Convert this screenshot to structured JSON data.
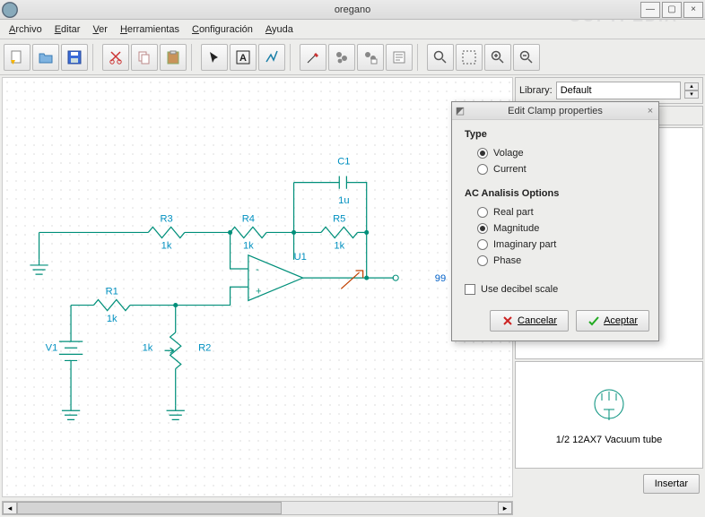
{
  "window": {
    "title": "oregano"
  },
  "menu": {
    "file": "Archivo",
    "edit": "Editar",
    "view": "Ver",
    "tools": "Herramientas",
    "config": "Configuración",
    "help": "Ayuda"
  },
  "toolbar": {
    "new": "new",
    "open": "open",
    "save": "save",
    "cut": "cut",
    "copy": "copy",
    "paste": "paste",
    "arrow": "arrow",
    "text": "text",
    "wire": "wire",
    "probe": "probe",
    "sim": "sim",
    "simopts": "sim-options",
    "log": "log",
    "zoomarea": "zoom-area",
    "zoom100": "zoom-100",
    "zoomin": "zoom-in",
    "zoomout": "zoom-out"
  },
  "library": {
    "label": "Library:",
    "selected": "Default"
  },
  "preview": {
    "part_name": "1/2 12AX7 Vacuum tube"
  },
  "insert_button": "Insertar",
  "schematic": {
    "components": {
      "c1": {
        "ref": "C1",
        "val": "1u"
      },
      "r1": {
        "ref": "R1",
        "val": "1k"
      },
      "r2": {
        "ref": "R2",
        "val": "1k"
      },
      "r3": {
        "ref": "R3",
        "val": "1k"
      },
      "r4": {
        "ref": "R4",
        "val": "1k"
      },
      "r5": {
        "ref": "R5",
        "val": "1k"
      },
      "u1": {
        "ref": "U1"
      },
      "v1": {
        "ref": "V1"
      }
    },
    "node_label": "99"
  },
  "dialog": {
    "title": "Edit Clamp properties",
    "type_label": "Type",
    "type_options": {
      "voltage": "Volage",
      "current": "Current"
    },
    "type_selected": "voltage",
    "ac_label": "AC Analisis Options",
    "ac_options": {
      "real": "Real part",
      "magnitude": "Magnitude",
      "imaginary": "Imaginary part",
      "phase": "Phase"
    },
    "ac_selected": "magnitude",
    "decibel": {
      "label": "Use decibel scale",
      "checked": false
    },
    "cancel": "Cancelar",
    "accept": "Aceptar"
  },
  "watermark": "SOFTPEDIA"
}
